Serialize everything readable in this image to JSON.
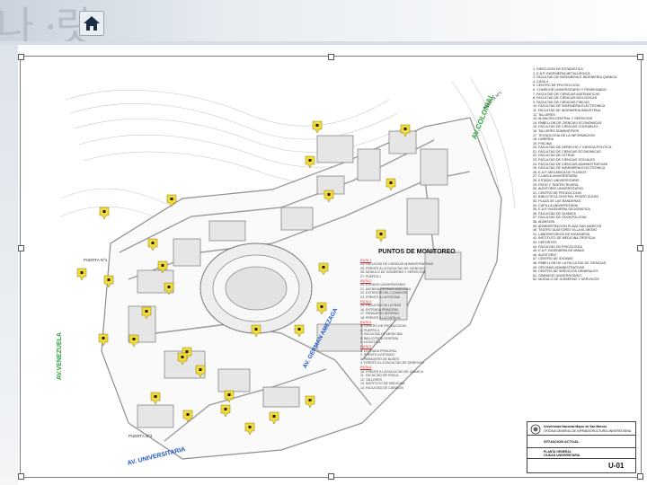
{
  "banner": {
    "deco_text": "나 ·랏"
  },
  "map": {
    "streets": {
      "av_colonial": "AV.COLONIAL",
      "av_venezuela": "AV.VENEZUELA",
      "av_german_amezaga": "AV. GERMAN AMEZAGA",
      "av_universitaria": "AV. UNIVERSITARIA",
      "puerta_1_top": "PUERTA Nº1",
      "puerta_1_left": "PUERTA Nº1",
      "puerta_3": "PUERTA Nº3"
    },
    "points_header": "PUNTOS DE MONITOREO"
  },
  "legend": [
    "1. DIRECCION DE ESTADISTICA",
    "2. E.A.P. INGENIERIA METALURGICA",
    "3. FACULTAD DE INGENIERIA E INGENIERIA QUIMICA",
    "4. CASA 4",
    "5. CENTRO DE PROYECCION",
    "6. COMEDOR UNIVERSITARIO Y PENSIONADO",
    "7. FACULTAD DE CIENCIAS MATEMATICAS",
    "8. FACULTAD DE CIENCIAS BIOLOGICAS",
    "9. FACULTAD DE CIENCIAS FISICAS",
    "10. FACULTAD DE INGENIERIA ELECTRONICA",
    "11. FACULTAD DE INGENIERIA INDUSTRIAL",
    "12. TALLERES",
    "13. ALMACEN CENTRAL Y SERVICIOS",
    "14. PABELLON DE CIENCIAS ECONOMICAS",
    "15. FACULTAD DE CIENCIAS CONTABLES",
    "16. TALLERES SUMINISTROS",
    "17. TECNOLOGIA DE LA INFORMACION",
    "18. LIBRERIA",
    "19. PISCINA",
    "20. FACULTAD DE DERECHO Y CIENCIA POLITICA",
    "21. FACULTAD DE CIENCIAS ECONOMICAS",
    "22. FACULTAD DE LETRAS",
    "23. FACULTAD DE CIENCIAS SOCIALES",
    "24. FACULTAD DE CIENCIAS ADMINISTRATIVAS",
    "25. FACULTAD DE INGENIERIA ELECTRONICA",
    "26. E.A.P. MECANICA DE FLUIDOS",
    "27. CLINICA UNIVERSITARIA",
    "28. ESTADIO UNIVERSITARIO",
    "29. PATIO Y TEATRO RIVERA",
    "30. AUDITORIO UNIVERSITARIO",
    "31. CENTRO DE PRODUCCION",
    "32. BIBLIOTECA CENTRAL PEDRO ZULEN",
    "33. PLAZA DE LAS BANDERAS",
    "34. CAPILLA UNIVERSITARIA",
    "35. E.A.P. INGENIERIA GEOGRAFICA",
    "36. FACULTAD DE QUIMICA",
    "37. FACULTAD DE ODONTOLOGIA",
    "38. ADMISION",
    "39. ADMINISTRACION PLAZA SAN MARCOS",
    "40. TEATRO AUDITORIO VILLA EL MEDIO",
    "41. LABORATORIOS DE INGENIERIA",
    "42. INSTITUTO DE MEDICINA TROPICAL",
    "43. DEPORTES",
    "44. FACULTAD DE PSICOLOGIA",
    "45. E.A.P. INGENIERIA DE MINAS",
    "46. AUDITORIO",
    "47. CENTRO DE IDIOMAS",
    "48. PABELLON DE LA FACULTAD DE CIENCIAS",
    "49. OFICINAS ADMINISTRATIVAS",
    "50. CENTRO DE SERVICIOS GENERALES",
    "51. GIMNASIO UNIVERSITARIO",
    "52. MODULO DE GOBIERNO Y SERVICIOS"
  ],
  "points": {
    "groups": [
      {
        "hd": "RUTA 1",
        "items": [
          "24. FACULTAD DE CIENCIAS ADMINISTRATIVAS",
          "25. FRENTE A LA FACULTAD DE CIENCIAS",
          "26. MODULO DE GOBIERNO Y SERVICIOS",
          "27. PUERTA 1"
        ]
      },
      {
        "hd": "RUTA 2",
        "items": [
          "20. ESTADIO UNIVERSITARIO",
          "21. AVENIDA GERMAN AMEZAGA",
          "22. EXTERIOR DEL COMEDOR",
          "23. FRENTE A LA PISCINA"
        ]
      },
      {
        "hd": "RUTA 3",
        "items": [
          "15. FACULTAD DE LETRAS",
          "16. ENTRADA PRINCIPAL",
          "17. PARADERO INTERNO",
          "18. FRENTE A LA CAPILLA"
        ]
      },
      {
        "hd": "RUTA 4",
        "items": [
          "5. CENTRO DE PRODUCCION",
          "6. PUERTA 3",
          "7. FACULTAD DE MEDICINA",
          "8. BIBLIOTECA CENTRAL",
          "9. LA BOTICA"
        ]
      },
      {
        "hd": "RUTA 5",
        "items": [
          "1. ENTRADA PRINCIPAL",
          "2. FRENTE A ESTADIO",
          "3. PARADERO DE BUSES",
          "4. FRENTE A LA FACULTAD DE DERECHO"
        ]
      },
      {
        "hd": "RUTA 6",
        "items": [
          "10. FRENTE A LA FACULTAD DE QUIMICA",
          "11. FACULTAD DE FISICA",
          "12. TALLERES",
          "13. INSTITUTO DE MEDICINA",
          "14. FACULTAD DE CIENCIAS"
        ]
      }
    ]
  },
  "titleblock": {
    "university": "Universidad Nacional Mayor de San Marcos",
    "office": "OFICINA GENERAL DE INFRAESTRUCTURA UNIVERSITARIA",
    "situation": "SITUACION ACTUAL",
    "plan": "PLANTA GENERAL",
    "place": "CIUDAD UNIVERSITARIA",
    "sheet": "U-01"
  },
  "colors": {
    "pin": "#f2dc3a",
    "pin_dot": "#1b1b1b",
    "street_green": "#2aa33c",
    "street_blue": "#1e56c8"
  }
}
